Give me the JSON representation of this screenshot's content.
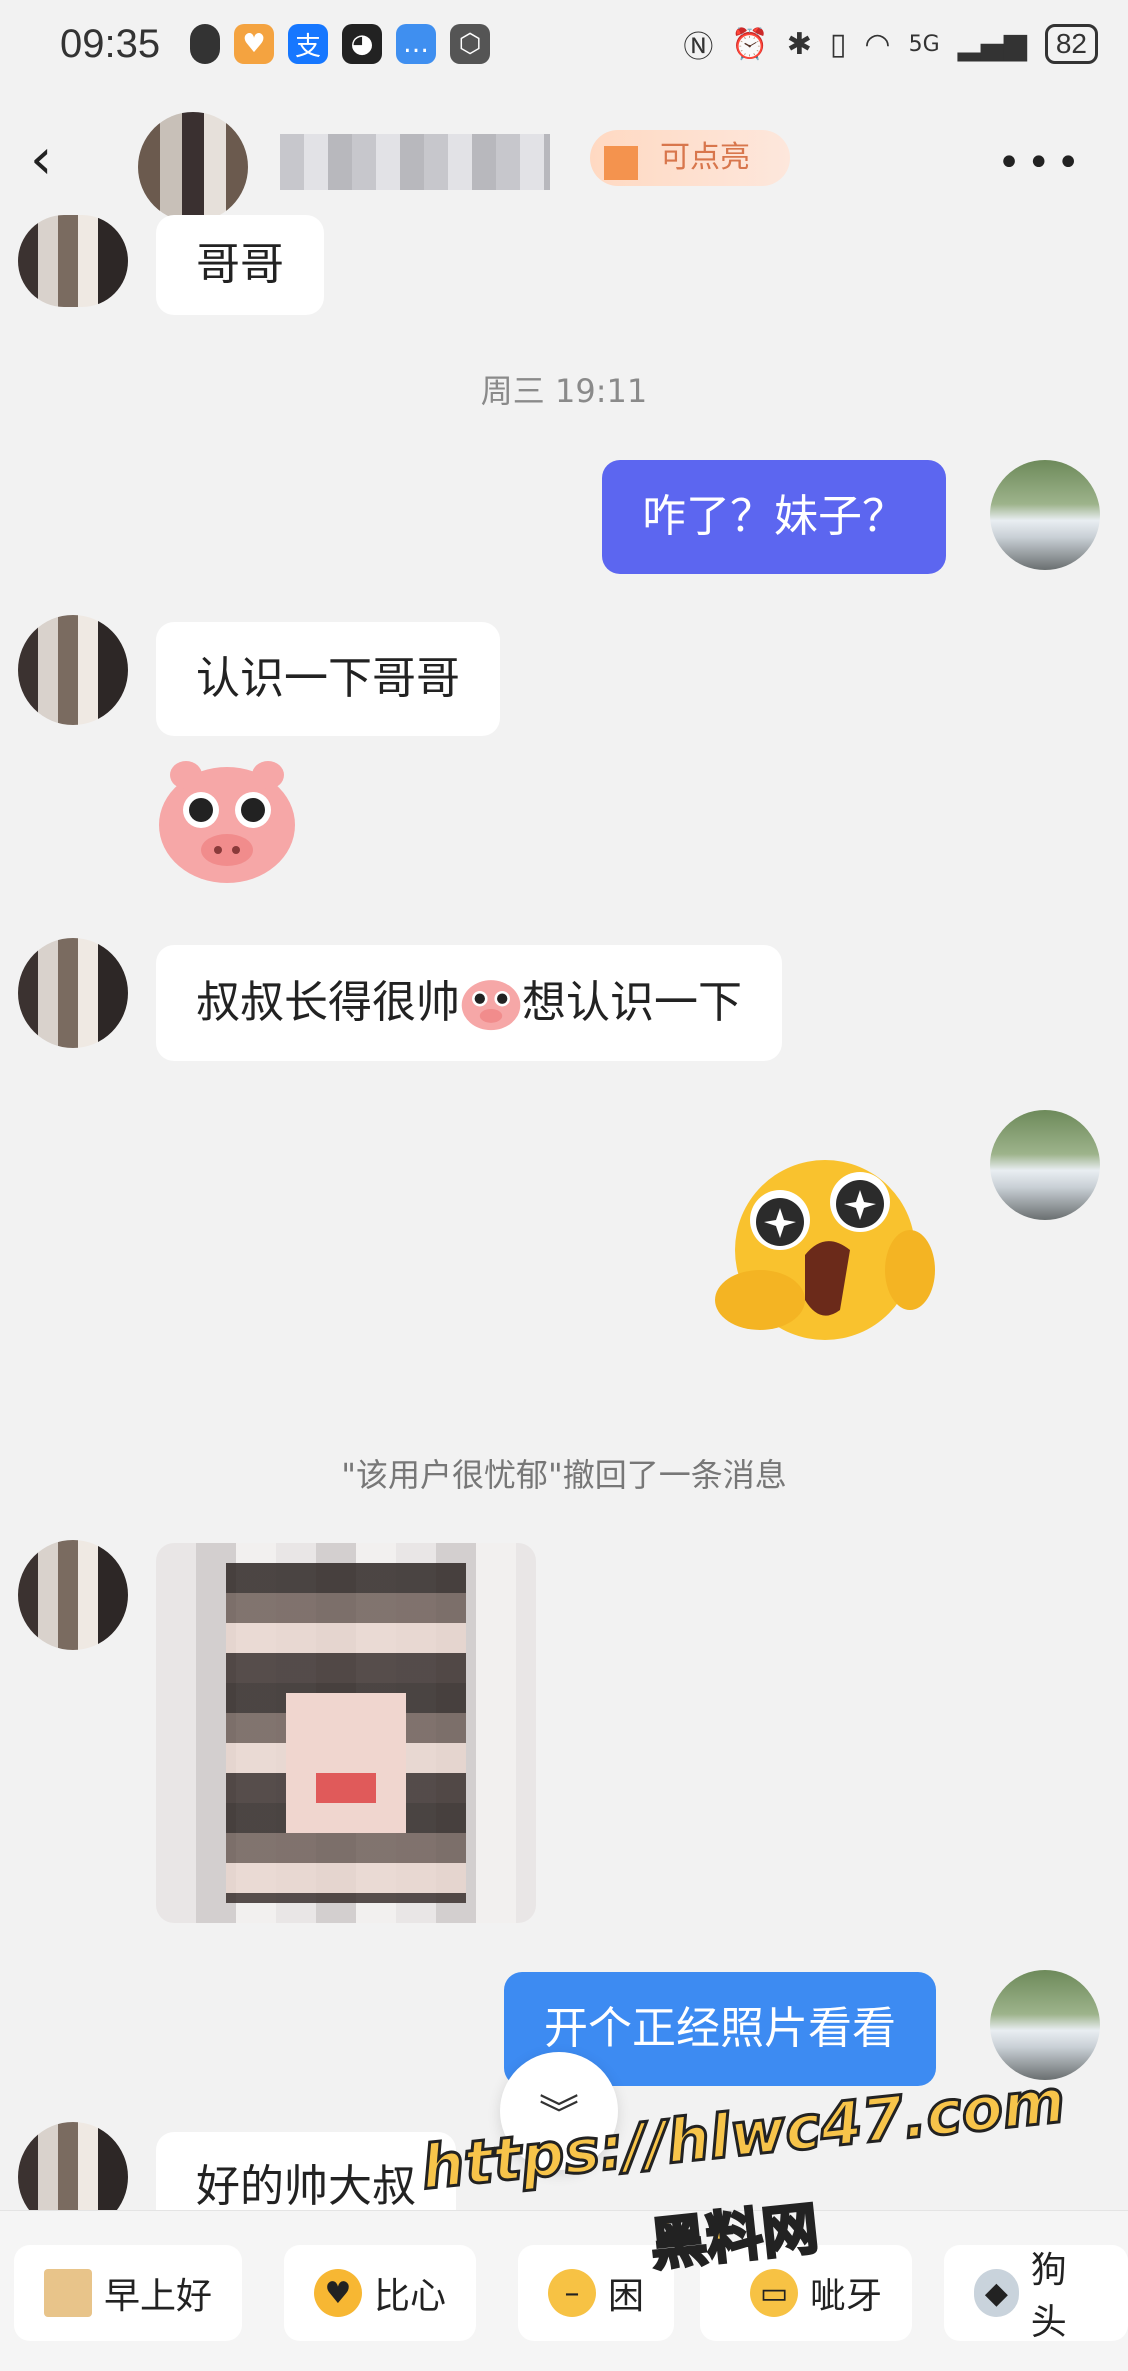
{
  "status_bar": {
    "time": "09:35",
    "network": "5G",
    "battery": "82"
  },
  "header": {
    "badge_text": "可点亮",
    "more_label": "•••"
  },
  "messages": [
    {
      "side": "left",
      "type": "text",
      "text": "哥哥"
    },
    {
      "type": "timestamp",
      "text": "周三 19:11"
    },
    {
      "side": "right",
      "type": "text",
      "text": "咋了？妹子？"
    },
    {
      "side": "left",
      "type": "text",
      "text": "认识一下哥哥"
    },
    {
      "side": "left",
      "type": "sticker",
      "sticker": "pig-face"
    },
    {
      "side": "left",
      "type": "text",
      "text_before": "叔叔长得很帅",
      "text_after": "想认识一下",
      "inline_emoji": "pig-face"
    },
    {
      "side": "right",
      "type": "sticker",
      "sticker": "surprised-yellow-face"
    },
    {
      "type": "system",
      "text": "\"该用户很忧郁\"撤回了一条消息"
    },
    {
      "side": "left",
      "type": "image",
      "image": "pixelated-photo"
    },
    {
      "side": "right",
      "type": "text",
      "text": "开个正经照片看看"
    },
    {
      "side": "left",
      "type": "text",
      "text": "好的帅大叔"
    }
  ],
  "quick_replies": [
    {
      "label": "早上好",
      "icon": "sun-emoji"
    },
    {
      "label": "比心",
      "icon": "heart-hands-emoji"
    },
    {
      "label": "困",
      "icon": "sleepy-emoji"
    },
    {
      "label": "呲牙",
      "icon": "grin-emoji"
    },
    {
      "label": "狗头",
      "icon": "doge-emoji"
    }
  ],
  "watermark": {
    "url": "https://hlwc47.com",
    "name": "黑料网"
  },
  "colors": {
    "my_bubble": "#5c66f0",
    "my_bubble_alt": "#3d8bf2",
    "background": "#f2f2f2"
  }
}
